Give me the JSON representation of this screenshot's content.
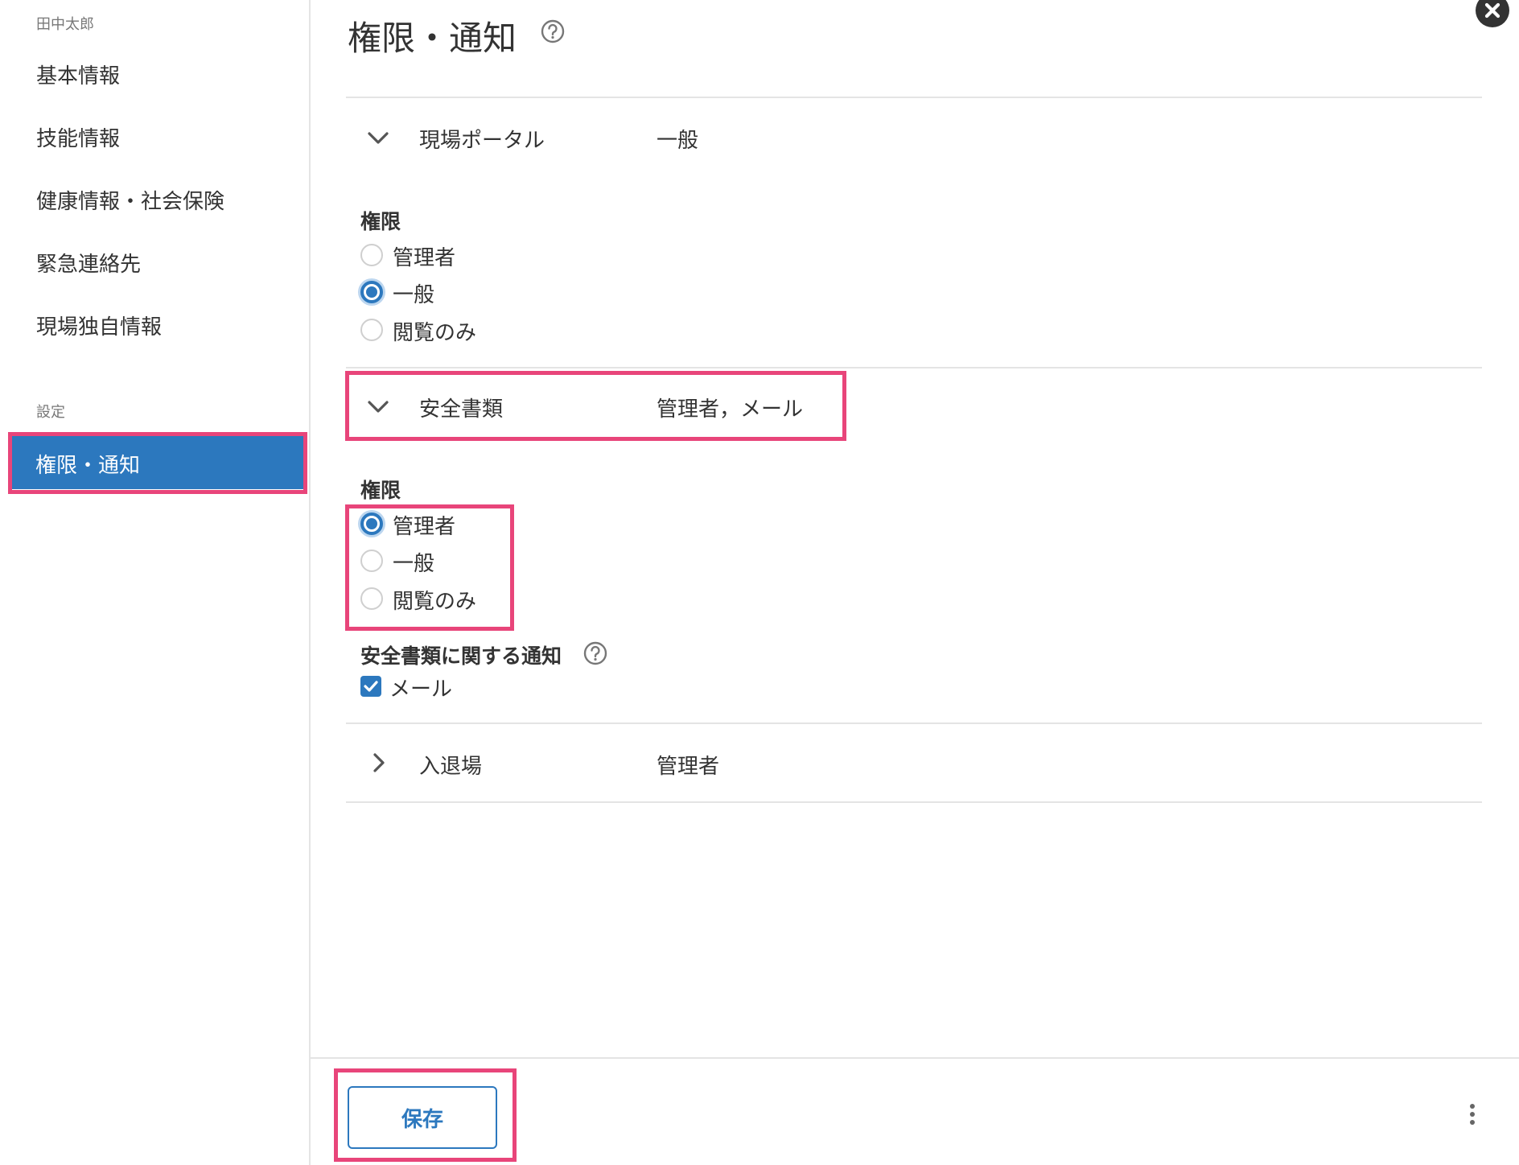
{
  "sidebar": {
    "user_name": "田中太郎",
    "items": [
      {
        "label": "基本情報"
      },
      {
        "label": "技能情報"
      },
      {
        "label": "健康情報・社会保険"
      },
      {
        "label": "緊急連絡先"
      },
      {
        "label": "現場独自情報"
      }
    ],
    "settings_section": "設定",
    "active_item": "権限・通知"
  },
  "main": {
    "title": "権限・通知",
    "sections": [
      {
        "name": "現場ポータル",
        "summary": "一般",
        "expanded": true,
        "permission_label": "権限",
        "options": [
          "管理者",
          "一般",
          "閲覧のみ"
        ],
        "selected": "一般"
      },
      {
        "name": "安全書類",
        "summary": "管理者，メール",
        "expanded": true,
        "permission_label": "権限",
        "options": [
          "管理者",
          "一般",
          "閲覧のみ"
        ],
        "selected": "管理者",
        "notification_label": "安全書類に関する通知",
        "notification_option": "メール",
        "notification_checked": true
      },
      {
        "name": "入退場",
        "summary": "管理者",
        "expanded": false
      }
    ]
  },
  "footer": {
    "save_label": "保存"
  },
  "colors": {
    "accent": "#2c78be",
    "highlight": "#e8457a"
  }
}
